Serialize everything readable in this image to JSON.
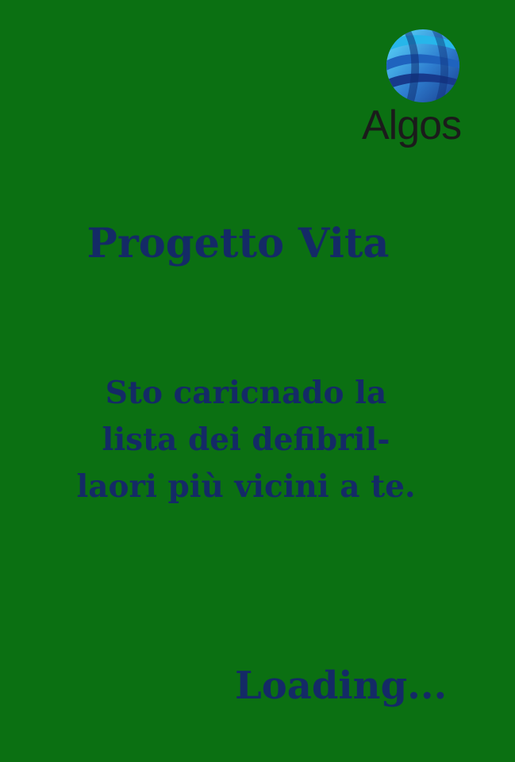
{
  "logo": {
    "icon": "globe-icon",
    "text": "Algos"
  },
  "title": "Progetto Vita",
  "message": {
    "lines": [
      "Sto caricnado la",
      "lista dei defibril-",
      "laori più vicini a te."
    ]
  },
  "loading": "Loading...",
  "colors": {
    "background": "#0b7012",
    "text": "#142a66",
    "logo_text": "#1b1b1b",
    "logo_blue_dark": "#1b4ea6",
    "logo_blue_light": "#3ab7e8"
  }
}
